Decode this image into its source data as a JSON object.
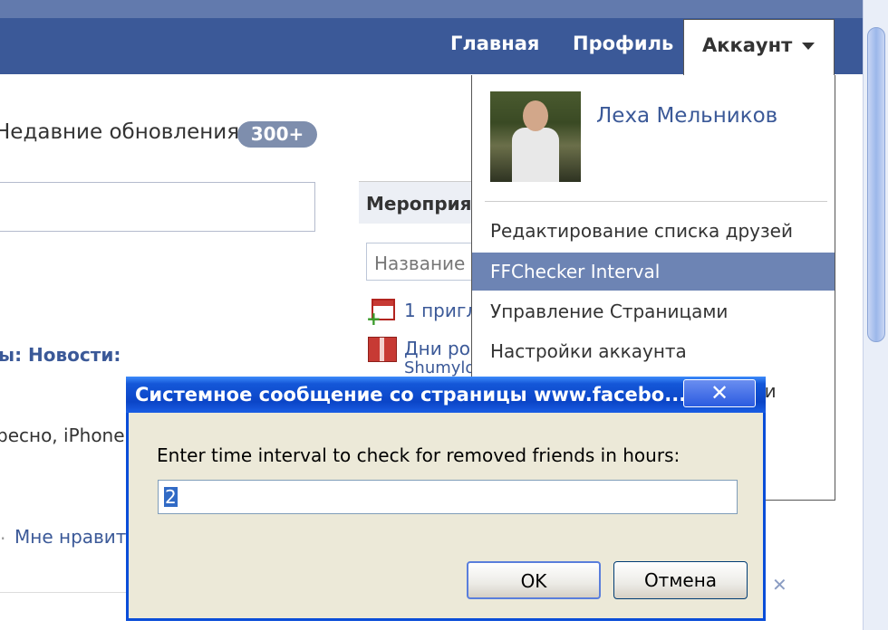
{
  "header": {
    "nav": [
      "Главная",
      "Профиль"
    ],
    "account_label": "Аккаунт"
  },
  "feed": {
    "recent_updates": "Недавние обновления",
    "badge": "300+",
    "news_label": "ы: Новости:",
    "feed_text": "ресно, iPhone",
    "like_text": "Мне нравит"
  },
  "events": {
    "title": "Мероприя",
    "input_placeholder": "Название",
    "invite_text": "1 пригл",
    "birthday_text": "Дни рож",
    "birthday_sub": "Shumylo"
  },
  "account_menu": {
    "user_name": "Леха Мельников",
    "items": [
      "Редактирование списка друзей",
      "FFChecker Interval",
      "Управление Страницами",
      "Настройки аккаунта",
      "сти"
    ],
    "selected_index": 1
  },
  "dialog": {
    "title": "Системное сообщение со страницы www.facebo...",
    "message": "Enter time interval to check for removed friends in hours:",
    "input_value": "2",
    "ok_label": "OK",
    "cancel_label": "Отмена"
  },
  "colors": {
    "facebook_blue": "#3b5998",
    "menu_highlight": "#6d84b4",
    "xp_title": "#0b45c7"
  }
}
